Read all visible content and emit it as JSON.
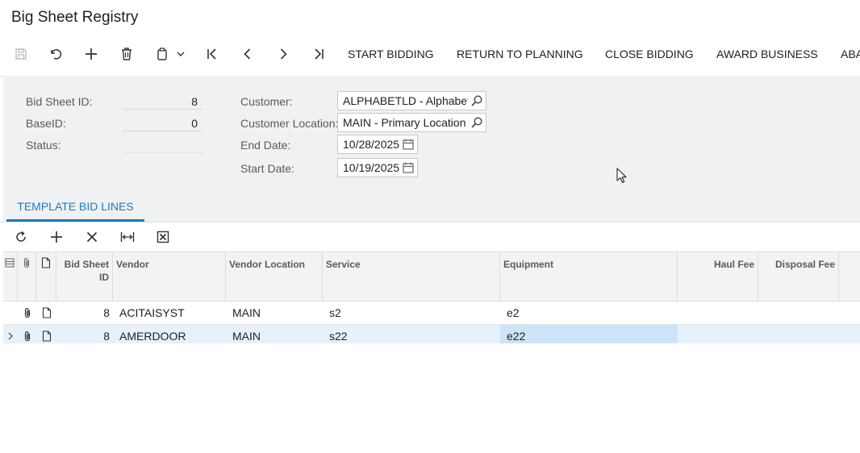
{
  "page": {
    "title": "Big Sheet Registry"
  },
  "toolbar": {
    "icons": {
      "save": "save-icon",
      "undo": "undo-icon",
      "add": "plus-icon",
      "delete": "trash-icon",
      "copy_paste": "clipboard-icon",
      "first": "first-record-icon",
      "prev": "previous-record-icon",
      "next": "next-record-icon",
      "last": "last-record-icon"
    },
    "start_bidding": "START BIDDING",
    "return_to_planning": "RETURN TO PLANNING",
    "close_bidding": "CLOSE BIDDING",
    "award_business": "AWARD BUSINESS",
    "abandon_truncated": "ABA"
  },
  "form": {
    "bid_sheet_id_label": "Bid Sheet ID:",
    "bid_sheet_id_value": "8",
    "base_id_label": "BaseID:",
    "base_id_value": "0",
    "status_label": "Status:",
    "status_value": "",
    "customer_label": "Customer:",
    "customer_value": "ALPHABETLD - Alphabetla",
    "customer_location_label": "Customer Location:",
    "customer_location_value": "MAIN - Primary Location",
    "end_date_label": "End Date:",
    "end_date_value": "10/28/2025",
    "start_date_label": "Start Date:",
    "start_date_value": "10/19/2025"
  },
  "tabs": {
    "template_bid_lines": "TEMPLATE BID LINES"
  },
  "grid": {
    "columns": {
      "bid_sheet_id": "Bid Sheet ID",
      "vendor": "Vendor",
      "vendor_location": "Vendor Location",
      "service": "Service",
      "equipment": "Equipment",
      "haul_fee": "Haul Fee",
      "disposal_fee": "Disposal Fee"
    },
    "rows": [
      {
        "bid_sheet_id": "8",
        "vendor": "ACITAISYST",
        "vendor_location": "MAIN",
        "service": "s2",
        "equipment": "e2",
        "haul_fee": "",
        "disposal_fee": ""
      },
      {
        "bid_sheet_id": "8",
        "vendor": "AMERDOOR",
        "vendor_location": "MAIN",
        "service": "s22",
        "equipment": "e22",
        "haul_fee": "",
        "disposal_fee": ""
      }
    ]
  },
  "colors": {
    "accent": "#1a7cc0",
    "panel_bg": "#f0f1f3",
    "selected_row": "#e6f1fb",
    "selected_cell": "#cde3f7"
  }
}
